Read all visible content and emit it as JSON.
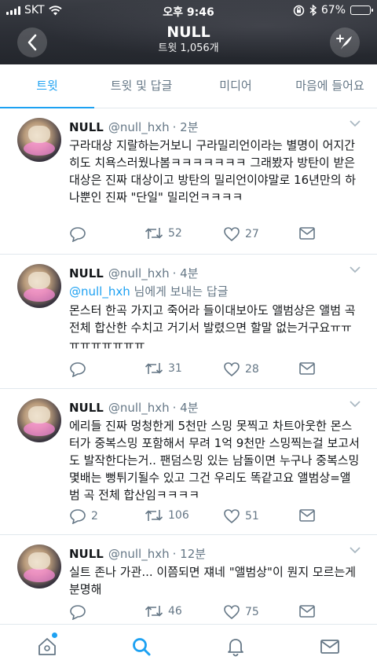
{
  "status_bar": {
    "carrier": "SKT",
    "time": "오후 9:46",
    "battery": "67%",
    "battery_level": 0.67
  },
  "header": {
    "title": "NULL",
    "subtitle": "트윗 1,056개"
  },
  "tabs": [
    {
      "label": "트윗",
      "active": true
    },
    {
      "label": "트윗 및 답글",
      "active": false
    },
    {
      "label": "미디어",
      "active": false
    },
    {
      "label": "마음에 들어요",
      "active": false
    }
  ],
  "tweets": [
    {
      "name": "NULL",
      "handle": "@null_hxh",
      "time": "· 2분",
      "text": "구라대상 지랄하는거보니 구라밀리언이라는 별명이 어지간히도 치욕스러웠나봄ㅋㅋㅋㅋㅋㅋㅋ 그래봤자 방탄이 받은 대상은 진짜 대상이고 방탄의 밀리언이야말로 16년만의 하나뿐인 진짜 \"단일\" 밀리언ㅋㅋㅋㅋ",
      "replies": "",
      "retweets": "52",
      "likes": "27"
    },
    {
      "name": "NULL",
      "handle": "@null_hxh",
      "time": "· 4분",
      "reply_to_mention": "@null_hxh",
      "reply_to_suffix": " 님에게 보내는 답글",
      "text": "몬스터 한곡 가지고 죽어라 들이대보아도 앨범상은 앨범 곡 전체 합산한 수치고 거기서 발렸으면 할말 없는거구요ㅠㅠㅠㅠㅠㅠㅠㅠㅠ",
      "replies": "",
      "retweets": "31",
      "likes": "28"
    },
    {
      "name": "NULL",
      "handle": "@null_hxh",
      "time": "· 4분",
      "text": "에리들 진짜 멍청한게 5천만 스밍 못찍고 차트아웃한 몬스터가 중복스밍 포함해서 무려 1억 9천만 스밍찍는걸 보고서도 발작한다는거.. 팬덤스밍 있는 남돌이면 누구나 중복스밍 몇배는 뻥튀기될수 있고 그건 우리도 똑같고요 앨범상=앨범 곡 전체 합산임ㅋㅋㅋㅋ",
      "replies": "2",
      "retweets": "106",
      "likes": "51"
    },
    {
      "name": "NULL",
      "handle": "@null_hxh",
      "time": "· 12분",
      "text": "실트 존나 가관... 이쯤되면 쟤네 \"앨범상\"이 뭔지 모르는게 분명해",
      "replies": "",
      "retweets": "46",
      "likes": "75"
    }
  ],
  "icons": {
    "back": "chevron-left-icon",
    "compose": "compose-icon",
    "reply": "reply-icon",
    "retweet": "retweet-icon",
    "like": "heart-icon",
    "message": "envelope-icon",
    "nav_home": "home-icon",
    "nav_search": "search-icon",
    "nav_notifications": "bell-icon",
    "nav_messages": "envelope-icon"
  },
  "colors": {
    "accent": "#1da1f2",
    "muted": "#657786",
    "text": "#14171a"
  }
}
